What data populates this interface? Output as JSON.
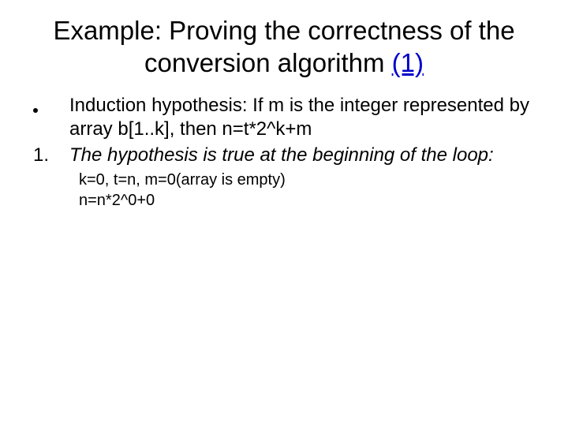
{
  "title": {
    "main": "Example: Proving the correctness of  the  conversion algorithm ",
    "accent": "(1)"
  },
  "bullets": {
    "hypothesis": "Induction hypothesis: If m is the integer represented by array b[1..k], then n=t*2^k+m",
    "step1_marker": "1.",
    "step1_text": "The hypothesis is true at the beginning of the loop:"
  },
  "sub": {
    "line1": "k=0, t=n, m=0(array is empty)",
    "line2": "n=n*2^0+0"
  }
}
